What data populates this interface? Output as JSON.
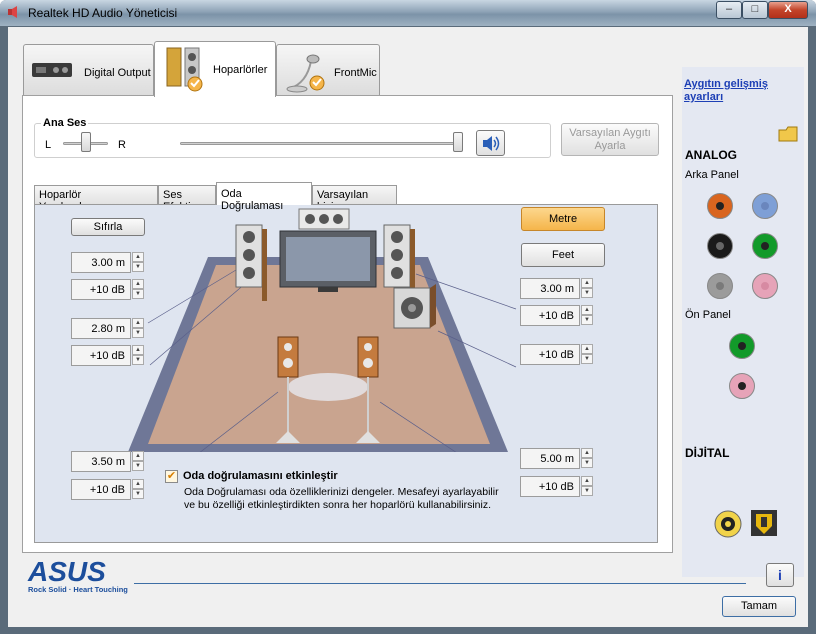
{
  "window": {
    "title": "Realtek HD Audio Yöneticisi",
    "close_glyph": "X",
    "min_glyph": "–",
    "max_glyph": "□"
  },
  "top_tabs": [
    {
      "label": "Digital Output"
    },
    {
      "label": "Hoparlörler"
    },
    {
      "label": "FrontMic"
    }
  ],
  "volume": {
    "group_title": "Ana Ses",
    "left_label": "L",
    "right_label": "R",
    "balance": 0.5,
    "level": 1.0,
    "default_device_button": "Varsayılan Aygıtı\nAyarla"
  },
  "sub_tabs": [
    {
      "label": "Hoparlör Yapılandırması"
    },
    {
      "label": "Ses Efekti"
    },
    {
      "label": "Oda Doğrulaması"
    },
    {
      "label": "Varsayılan biçim"
    }
  ],
  "room": {
    "reset_button": "Sıfırla",
    "meter_button": "Metre",
    "feet_button": "Feet",
    "fields": {
      "front_left_distance": "3.00  m",
      "front_left_gain": "+10 dB",
      "center_distance": "2.80  m",
      "center_gain": "+10 dB",
      "rear_left_distance": "3.50  m",
      "rear_left_gain": "+10 dB",
      "front_right_distance": "3.00  m",
      "front_right_gain": "+10 dB",
      "sub_gain": "+10 dB",
      "rear_right_distance": "5.00  m",
      "rear_right_gain": "+10 dB"
    },
    "enable_checkbox_label": "Oda doğrulamasını etkinleştir",
    "enable_checked": true,
    "description_line1": "Oda Doğrulaması oda özelliklerinizi dengeler. Mesafeyi ayarlayabilir",
    "description_line2": "ve bu özelliği etkinleştirdikten sonra her hoparlörü kullanabilirsiniz."
  },
  "right_panel": {
    "advanced_link_line1": "Aygıtın gelişmiş",
    "advanced_link_line2": "ayarları",
    "analog_header": "ANALOG",
    "rear_panel_label": "Arka Panel",
    "front_panel_label": "Ön Panel",
    "digital_header": "DİJİTAL",
    "jack_colors": {
      "orange": "#d9651f",
      "blue": "#7e9fd6",
      "black": "#1a1a1a",
      "green": "#129a2a",
      "gray": "#9b9b9b",
      "pink": "#e6a3b8"
    }
  },
  "footer": {
    "logo_text": "ASUS",
    "tagline": "Rock Solid · Heart Touching",
    "ok_button": "Tamam",
    "info_glyph": "i"
  },
  "colors": {
    "accent_orange": "#f5b54a",
    "link_blue": "#1d3fb5",
    "asus_blue": "#1c4e9c"
  }
}
